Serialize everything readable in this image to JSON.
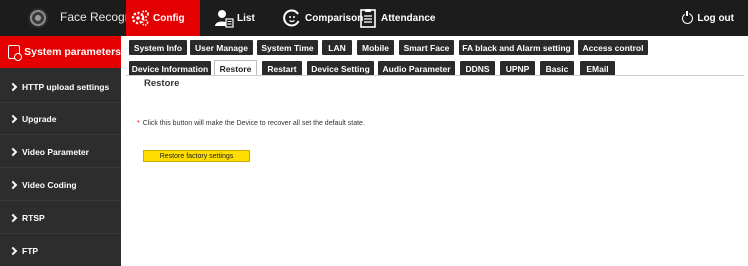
{
  "app": {
    "title": "Face Recognize"
  },
  "topnav": {
    "config": "Config",
    "list": "List",
    "comparison": "Comparison",
    "attendance": "Attendance",
    "logout": "Log out"
  },
  "sidebar": {
    "active": "System parameters",
    "items": [
      {
        "label": "HTTP upload settings"
      },
      {
        "label": "Upgrade"
      },
      {
        "label": "Video Parameter"
      },
      {
        "label": "Video Coding"
      },
      {
        "label": "RTSP"
      },
      {
        "label": "FTP"
      }
    ]
  },
  "tabs_row1": [
    {
      "label": "System Info"
    },
    {
      "label": "User Manage"
    },
    {
      "label": "System Time"
    },
    {
      "label": "LAN"
    },
    {
      "label": "Mobile"
    },
    {
      "label": "Smart Face"
    },
    {
      "label": "FA black and Alarm setting"
    },
    {
      "label": "Access control"
    }
  ],
  "tabs_row2": [
    {
      "label": "Device Information"
    },
    {
      "label": "Restore",
      "active": true
    },
    {
      "label": "Restart"
    },
    {
      "label": "Device Setting"
    },
    {
      "label": "Audio Parameter"
    },
    {
      "label": "DDNS"
    },
    {
      "label": "UPNP"
    },
    {
      "label": "Basic"
    },
    {
      "label": "EMail"
    }
  ],
  "content": {
    "title": "Restore",
    "hint_star": "*",
    "hint": "Click this button will make the Device to recover all set the default state.",
    "button": "Restore factory settings"
  },
  "colors": {
    "accent": "#e40000",
    "topbar": "#1c1c1c",
    "sidebar": "#2d2d2d",
    "button": "#ffdd00"
  }
}
